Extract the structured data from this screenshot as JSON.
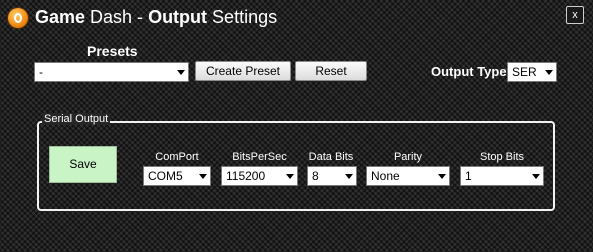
{
  "window": {
    "title_part1": "Game",
    "title_part2": " Dash - ",
    "title_part3": "Output",
    "title_part4": " Settings",
    "close_label": "x"
  },
  "presets": {
    "label": "Presets",
    "selected": "-",
    "create_button": "Create Preset",
    "reset_button": "Reset"
  },
  "output_type": {
    "label": "Output Type",
    "selected": "SER"
  },
  "serial_output": {
    "group_label": "Serial Output",
    "save_button": "Save",
    "fields": [
      {
        "label": "ComPort",
        "value": "COM5"
      },
      {
        "label": "BitsPerSec",
        "value": "115200"
      },
      {
        "label": "Data Bits",
        "value": "8"
      },
      {
        "label": "Parity",
        "value": "None"
      },
      {
        "label": "Stop Bits",
        "value": "1"
      }
    ]
  },
  "colors": {
    "save_button_bg": "#c9f5c6",
    "app_icon": "#f08a14"
  }
}
